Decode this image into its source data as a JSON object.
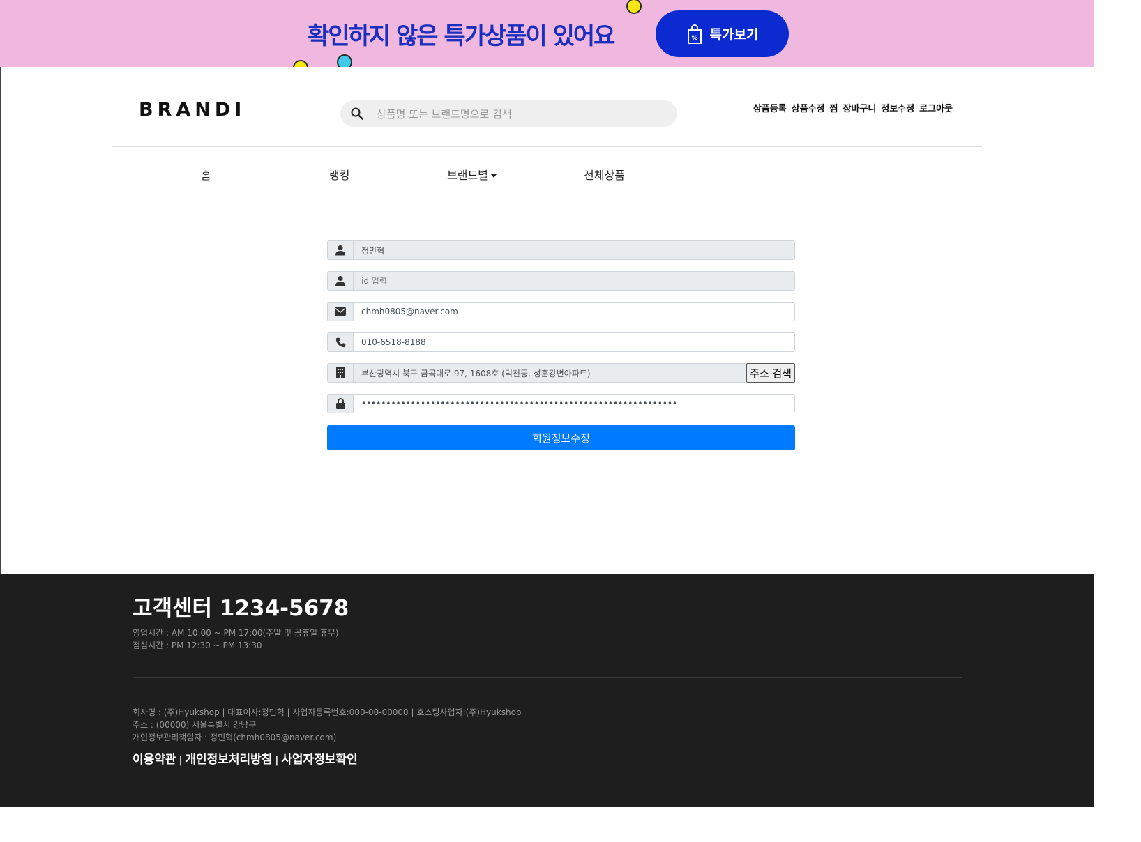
{
  "promo": {
    "text": "확인하지 않은 특가상품이 있어요",
    "button_label": "특가보기",
    "background": "#f0b8de",
    "text_color": "#1a2fbf",
    "button_color": "#0b2bd0"
  },
  "header": {
    "logo": "BRANDI",
    "search_placeholder": "상품명 또는 브랜드명으로 검색",
    "util_links": [
      "상품등록",
      "상품수정",
      "찜",
      "장바구니",
      "정보수정",
      "로그아웃"
    ]
  },
  "nav": {
    "items": [
      "홈",
      "랭킹",
      "브랜드별",
      "전체상품"
    ]
  },
  "form": {
    "name": "정민혁",
    "id_placeholder": "id 입력",
    "email": "chmh0805@naver.com",
    "phone": "010-6518-8188",
    "address": "부산광역시 북구 금곡대로 97, 1608호 (덕천동, 성훈강변아파트)",
    "address_button": "주소 검색",
    "password": "••••••••••••••••••••••••••••••••••••••••••••••••••••••••••••••••",
    "submit_label": "회원정보수정",
    "icons": [
      "user-icon",
      "user-icon",
      "envelope-icon",
      "phone-icon",
      "building-icon",
      "lock-icon"
    ],
    "submit_color": "#007bff"
  },
  "footer": {
    "cs_title": "고객센터 1234-5678",
    "hours_line1": "영업시간 : AM 10:00 ~ PM 17:00(주말 및 공휴일 휴무)",
    "hours_line2": "점심시간 : PM 12:30 ~ PM 13:30",
    "company_line1": "회사명 : (주)Hyukshop | 대표이사:정민혁 | 사업자등록번호:000-00-00000 | 호스팅사업자:(주)Hyukshop",
    "company_line2": "주소 : (00000) 서울특별시 강남구",
    "company_line3": "개인정보관리책임자 : 정민혁(chmh0805@naver.com)",
    "links": [
      "이용약관",
      "개인정보처리방침",
      "사업자정보확인"
    ],
    "link_separator": "|",
    "background": "#1e1e1e"
  }
}
